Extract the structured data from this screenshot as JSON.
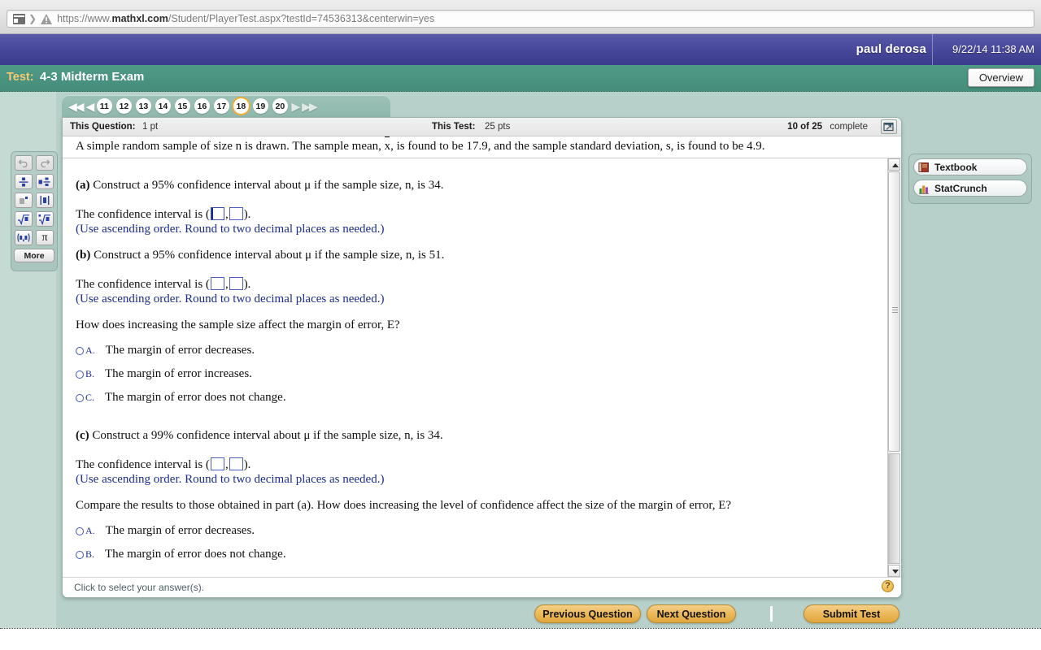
{
  "browser": {
    "url_prefix": "https://www.",
    "url_domain": "mathxl.com",
    "url_suffix": "/Student/PlayerTest.aspx?testId=74536313&centerwin=yes",
    "page_icon": "page-icon",
    "warning_icon": "warning-icon"
  },
  "header": {
    "user_name": "paul derosa",
    "date_time": "9/22/14 11:38 AM"
  },
  "test_bar": {
    "label": "Test:",
    "name": "4-3 Midterm Exam",
    "overview_button": "Overview"
  },
  "qnav": {
    "first_arrow": "◀◀",
    "prev_arrow": "◀",
    "next_arrow": "▶",
    "last_arrow": "▶▶",
    "numbers": [
      "11",
      "12",
      "13",
      "14",
      "15",
      "16",
      "17",
      "18",
      "19",
      "20"
    ],
    "current": "18"
  },
  "status_row": {
    "this_question_label": "This Question:",
    "this_question_value": "1 pt",
    "this_test_label": "This Test:",
    "this_test_value": "25 pts",
    "progress": "10 of 25",
    "complete": "complete",
    "popout_icon": "popout-window-icon"
  },
  "question": {
    "intro_pre": "A simple random sample of size n is drawn. The sample mean, ",
    "intro_xbar": "x",
    "intro_post": ", is found to be 17.9, and the sample standard deviation, s, is found to be 4.9.",
    "part_a": {
      "label": "(a)",
      "text": " Construct a 95% confidence interval about μ if the sample size, n, is 34.",
      "interval_pre": "The confidence interval is (",
      "interval_mid": ",",
      "interval_post": ").",
      "note": "(Use ascending order. Round to two decimal places as needed.)",
      "box1_value": "",
      "box2_value": ""
    },
    "part_b": {
      "label": "(b)",
      "text": " Construct a 95% confidence interval about μ if the sample size, n, is 51.",
      "interval_pre": "The confidence interval is (",
      "interval_mid": ",",
      "interval_post": ").",
      "note": "(Use ascending order. Round to two decimal places as needed.)",
      "box1_value": "",
      "box2_value": "",
      "prompt": "How does increasing the sample size affect the margin of error, E?",
      "options": [
        {
          "letter": "A.",
          "text": "The margin of error decreases.",
          "selected": false
        },
        {
          "letter": "B.",
          "text": "The margin of error increases.",
          "selected": false
        },
        {
          "letter": "C.",
          "text": "The margin of error does not change.",
          "selected": false
        }
      ]
    },
    "part_c": {
      "label": "(c)",
      "text": " Construct a 99% confidence interval about μ if the sample size, n, is 34.",
      "interval_pre": "The confidence interval is (",
      "interval_mid": ",",
      "interval_post": ").",
      "note": "(Use ascending order. Round to two decimal places as needed.)",
      "box1_value": "",
      "box2_value": "",
      "prompt": "Compare the results to those obtained in part (a). How does increasing the level of confidence affect the size of the margin of error, E?",
      "options": [
        {
          "letter": "A.",
          "text": "The margin of error decreases.",
          "selected": false
        },
        {
          "letter": "B.",
          "text": "The margin of error does not change.",
          "selected": false
        }
      ]
    }
  },
  "card_footer": {
    "hint": "Click to select your answer(s).",
    "help_label": "?"
  },
  "math_palette": {
    "buttons": [
      {
        "name": "undo-icon",
        "title": "Undo"
      },
      {
        "name": "redo-icon",
        "title": "Redo"
      },
      {
        "name": "fraction-icon",
        "title": "Fraction"
      },
      {
        "name": "mixed-number-icon",
        "title": "Mixed number"
      },
      {
        "name": "exponent-icon",
        "title": "Exponent"
      },
      {
        "name": "absolute-value-icon",
        "title": "Absolute value"
      },
      {
        "name": "square-root-icon",
        "title": "Square root"
      },
      {
        "name": "nth-root-icon",
        "title": "Nth root"
      },
      {
        "name": "interval-notation-icon",
        "title": "Interval notation"
      },
      {
        "name": "pi-icon",
        "title": "Pi"
      }
    ],
    "more_label": "More"
  },
  "tools_panel": {
    "textbook_label": "Textbook",
    "textbook_icon": "book-icon",
    "statcrunch_label": "StatCrunch",
    "statcrunch_icon": "bar-chart-icon"
  },
  "bottom_bar": {
    "previous_question": "Previous Question",
    "next_question": "Next Question",
    "submit_test": "Submit Test"
  },
  "colors": {
    "purple_header": "#4a4a9e",
    "teal_bar": "#47917f",
    "page_teal": "#c6dad4",
    "panel_teal": "#b7d0ca",
    "accent_gold": "#e0a73f",
    "answer_blue": "#1b2c8f",
    "current_ring": "#f0ad34"
  }
}
